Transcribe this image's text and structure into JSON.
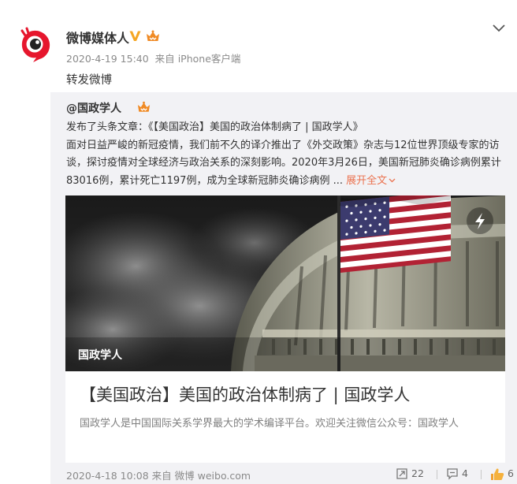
{
  "post": {
    "user_name": "微博媒体人",
    "time": "2020-4-19 15:40",
    "source_prefix": "来自",
    "source": "iPhone客户端",
    "repost_text": "转发微博",
    "menu_icon": "chevron-down-icon"
  },
  "original": {
    "author": "@国政学人",
    "text_parts": {
      "line1": "发布了头条文章：《【美国政治】美国的政治体制病了 | 国政学人》",
      "body": "面对日益严峻的新冠疫情，我们前不久的译介推出了《外交政策》杂志与12位世界顶级专家的访谈，探讨疫情对全球经济与政治关系的深刻影响。2020年3月26日，美国新冠肺炎确诊病例累计83016例，累计死亡1197例，成为全球新冠肺炎确诊病例 ...",
      "expand_label": "展开全文"
    },
    "card": {
      "image_label": "国政学人",
      "title": "【美国政治】美国的政治体制病了 | 国政学人",
      "desc": "国政学人是中国国际关系学界最大的学术编译平台。欢迎关注微信公众号：国政学人"
    },
    "footer": {
      "time": "2020-4-18 10:08",
      "source_prefix": "来自",
      "source": "微博 weibo.com",
      "repost_count": "22",
      "comment_count": "4",
      "like_count": "6"
    }
  },
  "colors": {
    "link_orange": "#eb7350",
    "verified_gold": "#f5a623",
    "weibo_red": "#e6162d"
  }
}
